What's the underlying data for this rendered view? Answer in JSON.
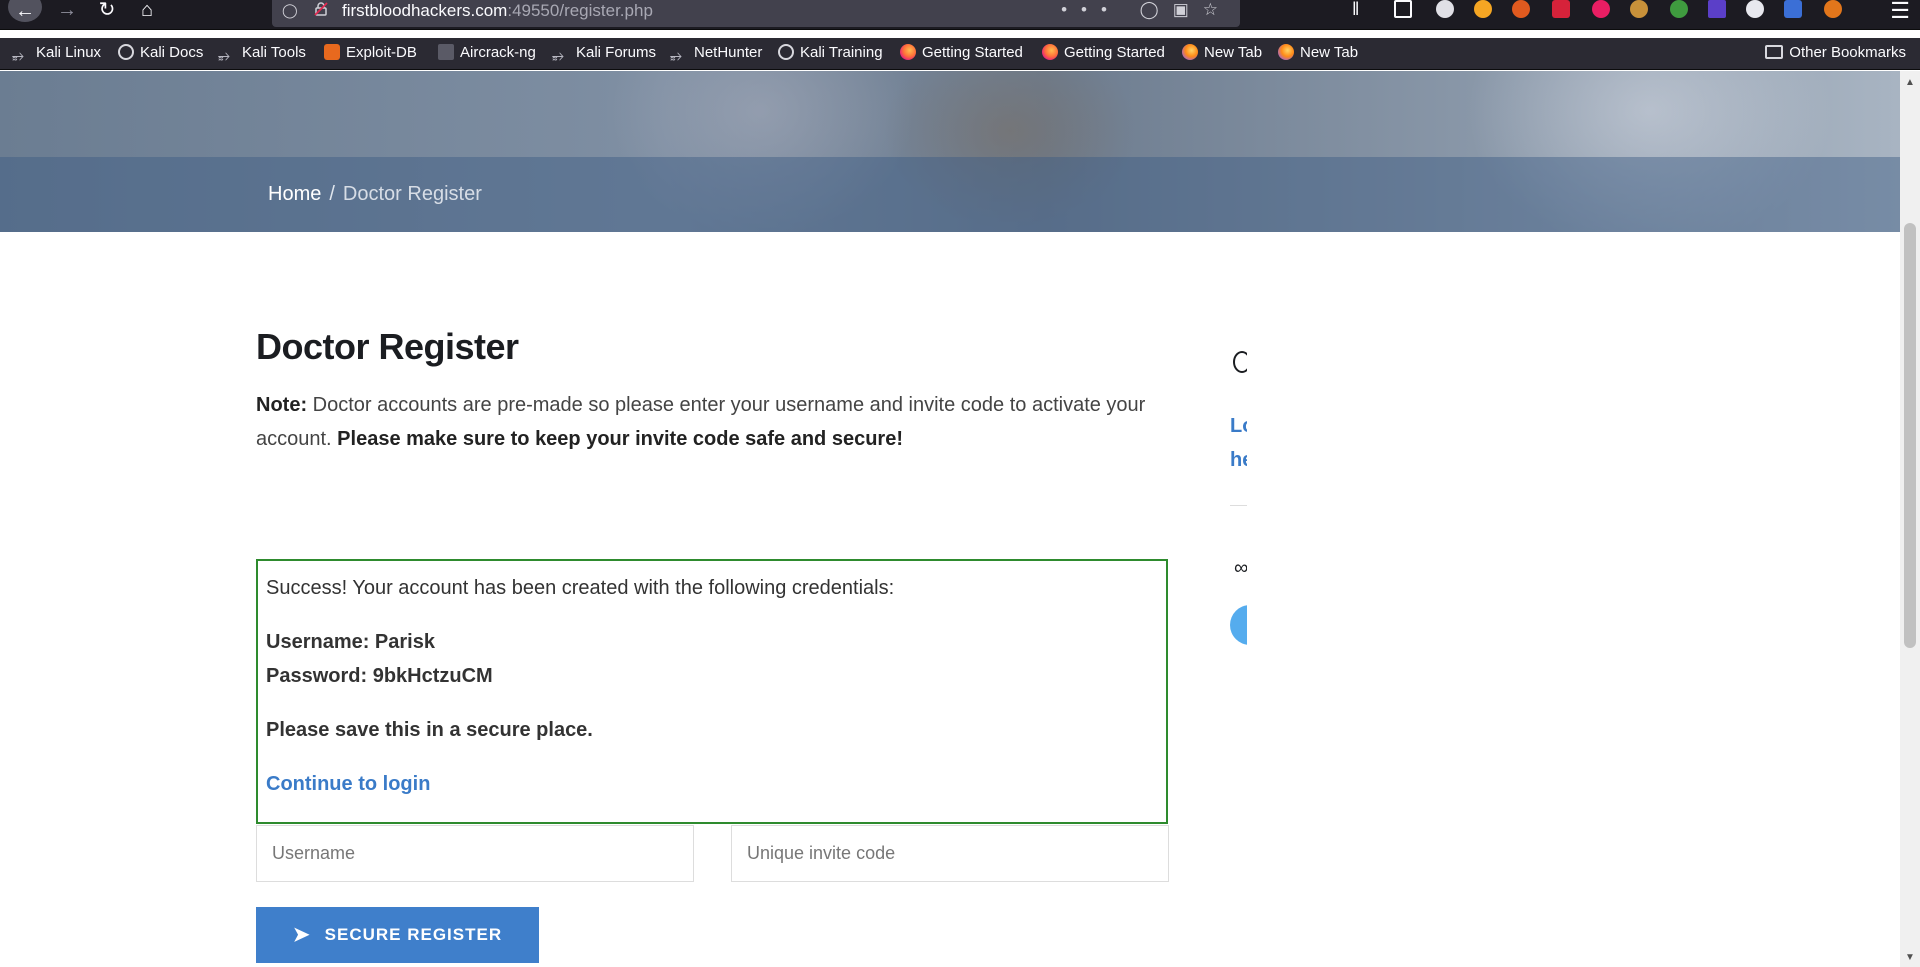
{
  "browser": {
    "url_domain": "firstbloodhackers.com",
    "url_path": ":49550/register.php",
    "icons": {
      "back": "back-arrow-icon",
      "forward": "forward-arrow-icon",
      "reload": "reload-icon",
      "home": "home-icon",
      "page_actions": "•••"
    },
    "bookmarks": [
      {
        "label": "Kali Linux",
        "icon": "kali-icon"
      },
      {
        "label": "Kali Docs",
        "icon": "globe-icon"
      },
      {
        "label": "Kali Tools",
        "icon": "kali-icon"
      },
      {
        "label": "Exploit-DB",
        "icon": "exploit-db-icon"
      },
      {
        "label": "Aircrack-ng",
        "icon": "aircrack-icon"
      },
      {
        "label": "Kali Forums",
        "icon": "kali-icon"
      },
      {
        "label": "NetHunter",
        "icon": "kali-icon"
      },
      {
        "label": "Kali Training",
        "icon": "globe-icon"
      },
      {
        "label": "Getting Started",
        "icon": "firefox-icon"
      },
      {
        "label": "Getting Started",
        "icon": "firefox-icon"
      },
      {
        "label": "New Tab",
        "icon": "firefox-icon"
      },
      {
        "label": "New Tab",
        "icon": "firefox-icon"
      }
    ],
    "other_bookmarks": "Other Bookmarks",
    "colors": {
      "toolbar": "#1c1b22",
      "urlbar": "#42414d",
      "bookmarks_bar": "#2b2a33"
    }
  },
  "page": {
    "hero": {
      "breadcrumb_home": "Home",
      "breadcrumb_sep": "/",
      "breadcrumb_current": "Doctor Register"
    },
    "title": "Doctor Register",
    "note_label": "Note:",
    "note_text": " Doctor accounts are pre-made so please enter your username and invite code to activate your account. ",
    "note_emphasis": "Please make sure to keep your invite code safe and secure!",
    "alert": {
      "message": "Success! Your account has been created with the following credentials:",
      "username_line": "Username: Parisk",
      "password_line": "Password: 9bkHctzuCM",
      "save_notice": "Please save this in a secure place.",
      "continue_link": "Continue to login",
      "border_color": "#2e8b2e"
    },
    "form": {
      "username_placeholder": "Username",
      "username_value": "",
      "invite_placeholder": "Unique invite code",
      "invite_value": "",
      "submit_label": "SECURE REGISTER",
      "submit_icon": "paper-plane-icon",
      "accent_color": "#3f7fcb"
    },
    "sidebar": {
      "link_line1": "Lo",
      "link_line2": "he"
    }
  }
}
